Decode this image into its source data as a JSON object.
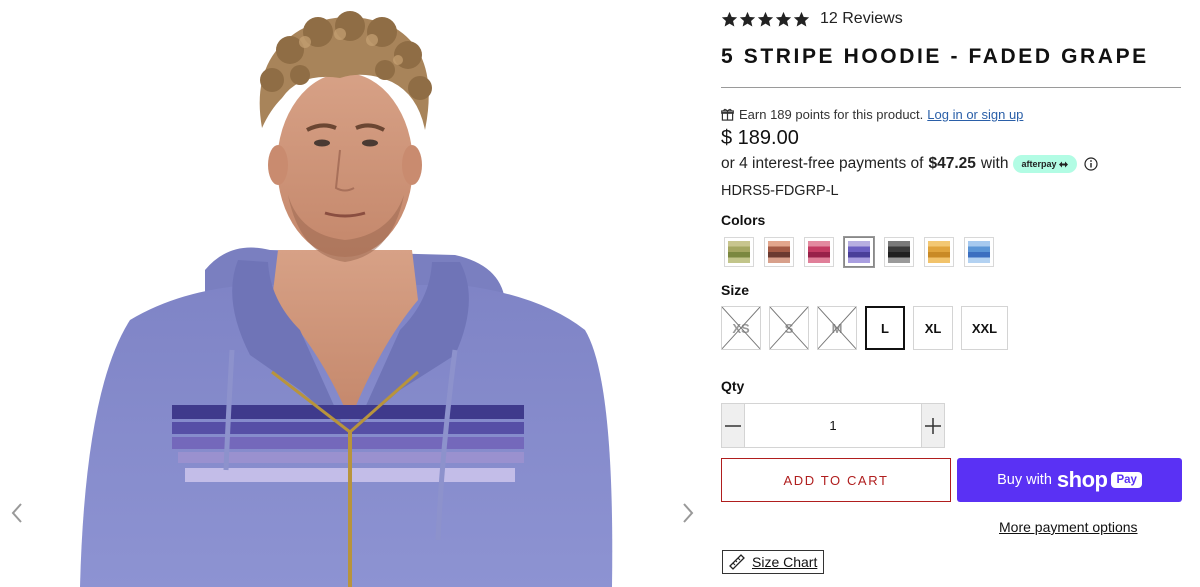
{
  "gallery": {
    "prev_icon": "chevron-left-icon",
    "next_icon": "chevron-right-icon"
  },
  "product": {
    "rating": 5,
    "reviews_label": "12 Reviews",
    "title": "5 STRIPE HOODIE - FADED GRAPE",
    "rewards_text": "Earn 189 points for this product.",
    "rewards_link": "Log in or sign up",
    "price": "$ 189.00",
    "installments_prefix": "or 4 interest-free payments of",
    "installments_amount": "$47.25",
    "installments_suffix": "with",
    "afterpay_label": "afterpay",
    "sku": "HDRS5-FDGRP-L"
  },
  "colors": {
    "label": "Colors",
    "selected_index": 3,
    "swatches": [
      {
        "name": "olive",
        "stripes": [
          "#c8c58e",
          "#a4a661",
          "#7b8840",
          "#c2c58a"
        ]
      },
      {
        "name": "rust",
        "stripes": [
          "#e2a68c",
          "#a35a44",
          "#6b3a30",
          "#d8a08b"
        ]
      },
      {
        "name": "berry",
        "stripes": [
          "#e38aa0",
          "#c33b63",
          "#98214a",
          "#e07f99"
        ]
      },
      {
        "name": "faded-grape",
        "stripes": [
          "#b7afe1",
          "#6b5fc1",
          "#4a3f99",
          "#a99ee0"
        ]
      },
      {
        "name": "charcoal",
        "stripes": [
          "#7a7a7a",
          "#3a3a3a",
          "#1f1f1f",
          "#9a9a9a"
        ]
      },
      {
        "name": "gold",
        "stripes": [
          "#f3c873",
          "#e0a43d",
          "#c98a26",
          "#f2c36b"
        ]
      },
      {
        "name": "sky",
        "stripes": [
          "#a6c9ef",
          "#5b95d6",
          "#3c6fc0",
          "#b3d2f2"
        ]
      }
    ]
  },
  "sizes": {
    "label": "Size",
    "options": [
      {
        "label": "XS",
        "available": false,
        "selected": false
      },
      {
        "label": "S",
        "available": false,
        "selected": false
      },
      {
        "label": "M",
        "available": false,
        "selected": false
      },
      {
        "label": "L",
        "available": true,
        "selected": true
      },
      {
        "label": "XL",
        "available": true,
        "selected": false
      },
      {
        "label": "XXL",
        "available": true,
        "selected": false
      }
    ]
  },
  "quantity": {
    "label": "Qty",
    "value": "1"
  },
  "actions": {
    "add_to_cart": "ADD TO CART",
    "buy_with": "Buy with",
    "shop_word": "shop",
    "pay_badge": "Pay",
    "more_payment": "More payment options",
    "size_chart": "Size Chart"
  },
  "colors_theme": {
    "accent_red": "#b01e1e",
    "shop_pay_purple": "#5a31f4",
    "afterpay_mint": "#b2fce4"
  }
}
